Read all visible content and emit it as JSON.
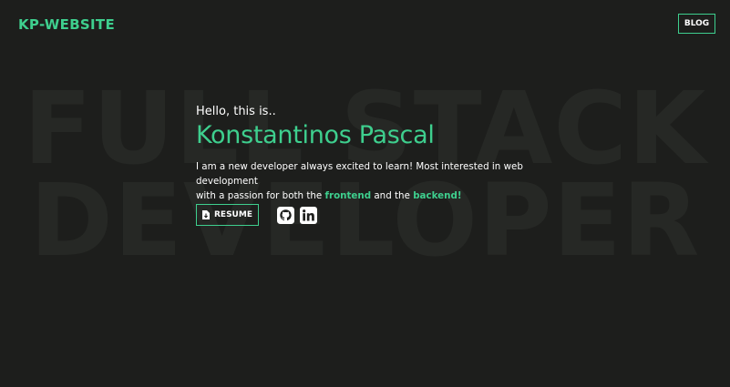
{
  "background": {
    "line1": "FULL STACK",
    "line2": "DEVELOPER"
  },
  "header": {
    "brand": "KP-WEBSITE",
    "blog_label": "BLOG"
  },
  "hero": {
    "greeting": "Hello, this is..",
    "name": "Konstantinos Pascal",
    "desc_line1": "I am a new developer always excited to learn! Most interested in web development",
    "desc_part1": "with a passion for both the ",
    "desc_highlight1": "frontend",
    "desc_part2": " and the ",
    "desc_highlight2": "backend!"
  },
  "actions": {
    "resume_label": "RESUME",
    "resume_icon": "file-download-icon",
    "github_icon": "github-icon",
    "linkedin_icon": "linkedin-icon"
  },
  "colors": {
    "background": "#1d1e1c",
    "accent": "#3ecf8e",
    "text": "#ffffff",
    "watermark": "#262825"
  }
}
